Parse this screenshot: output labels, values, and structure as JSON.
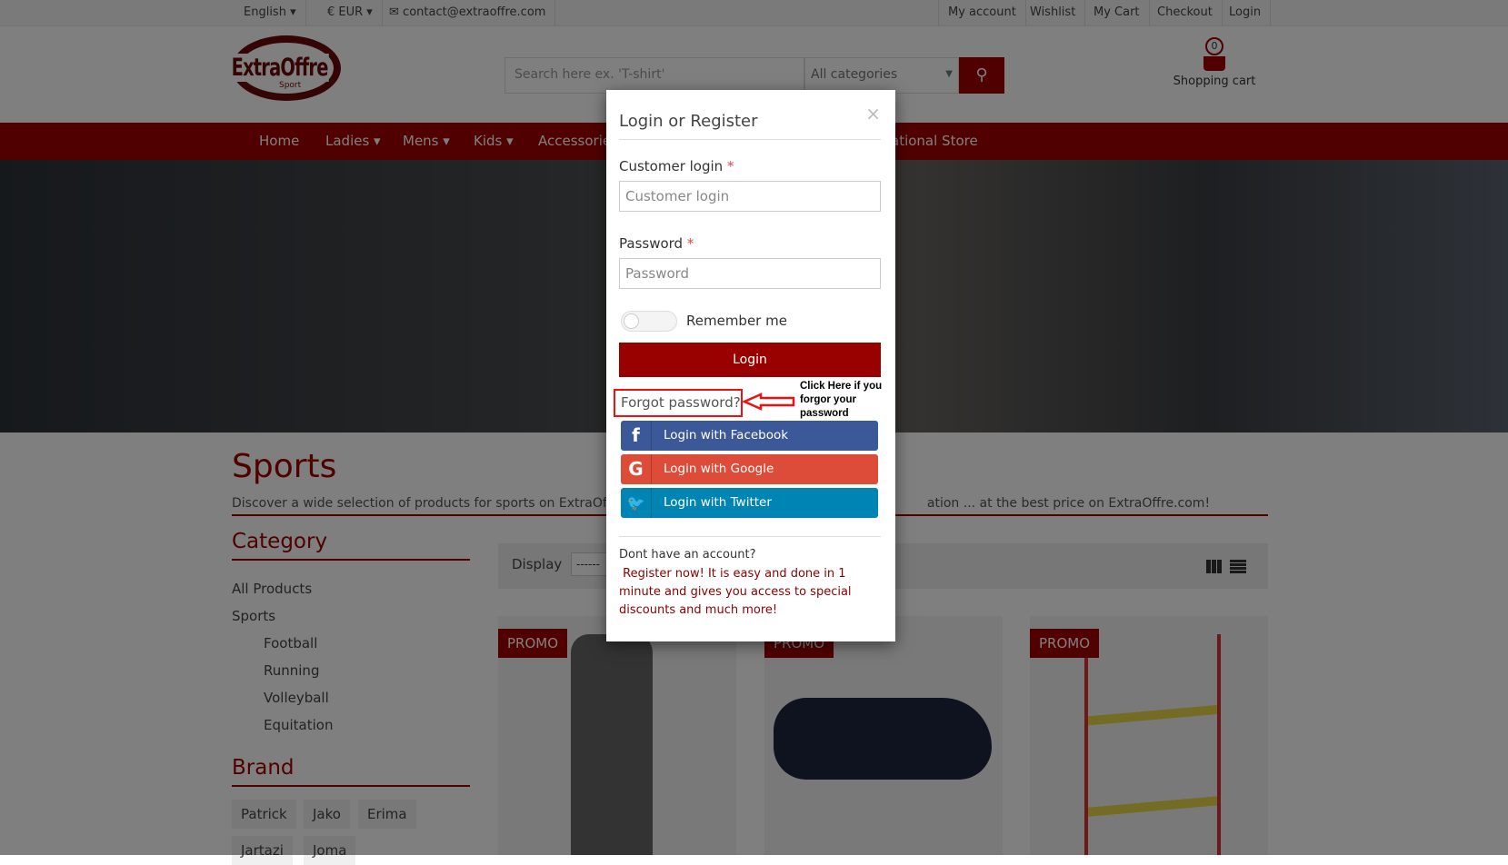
{
  "topbar": {
    "language": "English",
    "currency": "€ EUR",
    "email": "contact@extraoffre.com",
    "links": [
      "My account",
      "Wishlist",
      "My Cart",
      "Checkout",
      "Login"
    ]
  },
  "header": {
    "logo_text": "ExtraOffre",
    "logo_sub": "Sport",
    "search_placeholder": "Search here ex. 'T-shirt'",
    "category": "All categories",
    "cart_count": "0",
    "cart_label": "Shopping cart"
  },
  "nav": [
    "Home",
    "Ladies",
    "Mens",
    "Kids",
    "Accessories",
    "ational Store"
  ],
  "page": {
    "title": "Sports",
    "description": "Discover a wide selection of products for sports on ExtraOffre S",
    "description_end": "ation ... at the best price on ExtraOffre.com!"
  },
  "sidebar": {
    "category_title": "Category",
    "categories": [
      "All Products",
      "Sports",
      "Football",
      "Running",
      "Volleyball",
      "Equitation"
    ],
    "brand_title": "Brand",
    "brands": [
      "Patrick",
      "Jako",
      "Erima",
      "Jartazi",
      "Joma"
    ]
  },
  "toolbar": {
    "display_label": "Display",
    "display_value": "------"
  },
  "products": [
    {
      "badge": "PROMO"
    },
    {
      "badge": "PROMO"
    },
    {
      "badge": "PROMO"
    }
  ],
  "modal": {
    "title": "Login or Register",
    "close": "×",
    "login_label": "Customer login",
    "login_placeholder": "Customer login",
    "required": "*",
    "password_label": "Password",
    "password_placeholder": "Password",
    "remember": "Remember me",
    "login_button": "Login",
    "forgot": "Forgot password?",
    "annotation": "Click Here if you forgor your password",
    "social": [
      {
        "label": "Login with Facebook",
        "color": "#3b5998",
        "icon": "f"
      },
      {
        "label": "Login with Google",
        "color": "#dd4b39",
        "icon": "G"
      },
      {
        "label": "Login with Twitter",
        "color": "#0084b4",
        "icon": "🐦"
      }
    ],
    "no_account": "Dont have an account?",
    "register": "Register now! It is easy and done in 1 minute and gives you access to special discounts and much more!"
  },
  "colors": {
    "brand": "#a30000",
    "login": "#990000"
  }
}
